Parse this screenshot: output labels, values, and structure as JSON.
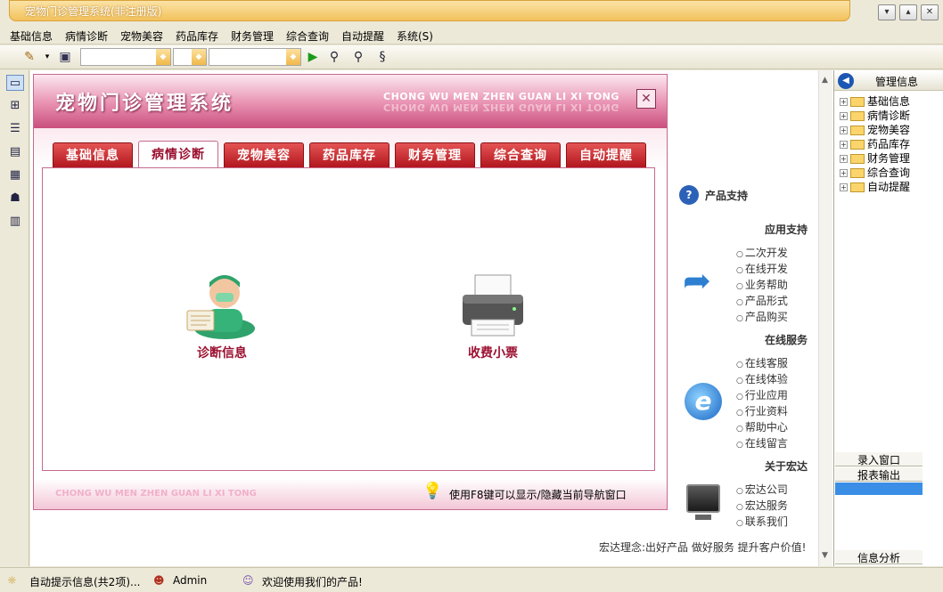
{
  "window": {
    "title": "宠物门诊管理系统(非注册版)"
  },
  "menu": [
    {
      "label": "基础信息"
    },
    {
      "label": "病情诊断"
    },
    {
      "label": "宠物美容"
    },
    {
      "label": "药品库存"
    },
    {
      "label": "财务管理"
    },
    {
      "label": "综合查询"
    },
    {
      "label": "自动提醒"
    },
    {
      "label": "系统(S)"
    }
  ],
  "nav": {
    "title": "宠物门诊管理系统",
    "subtitle": "CHONG WU MEN ZHEN GUAN LI XI TONG",
    "tabs": [
      {
        "label": "基础信息"
      },
      {
        "label": "病情诊断"
      },
      {
        "label": "宠物美容"
      },
      {
        "label": "药品库存"
      },
      {
        "label": "财务管理"
      },
      {
        "label": "综合查询"
      },
      {
        "label": "自动提醒"
      }
    ],
    "active_tab": "病情诊断",
    "items": [
      {
        "label": "诊断信息"
      },
      {
        "label": "收费小票"
      }
    ],
    "footer_en": "CHONG WU MEN ZHEN  GUAN LI XI TONG",
    "footer_tip": "使用F8键可以显示/隐藏当前导航窗口"
  },
  "support": {
    "product_support": "产品支持",
    "app_support": {
      "heading": "应用支持",
      "links": [
        "二次开发",
        "在线开发",
        "业务帮助",
        "产品形式",
        "产品购买"
      ]
    },
    "online_service": {
      "heading": "在线服务",
      "links": [
        "在线客服",
        "在线体验",
        "行业应用",
        "行业资料",
        "帮助中心",
        "在线留言"
      ]
    },
    "about": {
      "heading": "关于宏达",
      "links": [
        "宏达公司",
        "宏达服务",
        "联系我们"
      ]
    },
    "slogan": "宏达理念:出好产品  做好服务  提升客户价值!"
  },
  "right_panel": {
    "header": "管理信息",
    "tree": [
      "基础信息",
      "病情诊断",
      "宠物美容",
      "药品库存",
      "财务管理",
      "综合查询",
      "自动提醒"
    ],
    "buttons": {
      "entry": "录入窗口",
      "report": "报表输出",
      "analysis": "信息分析"
    }
  },
  "status": {
    "alerts": "自动提示信息(共2项)...",
    "user": "Admin",
    "welcome": "欢迎使用我们的产品!"
  }
}
